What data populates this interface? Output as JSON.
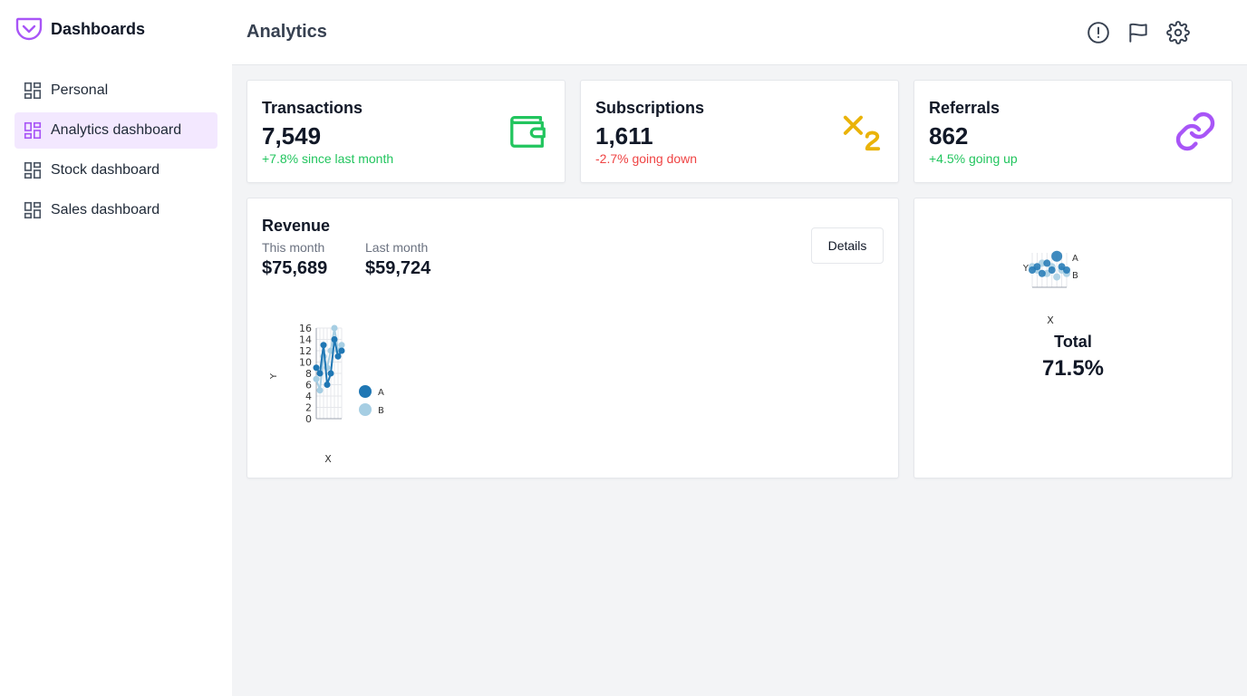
{
  "brand": {
    "title": "Dashboards"
  },
  "nav": [
    {
      "label": "Personal",
      "active": false
    },
    {
      "label": "Analytics dashboard",
      "active": true
    },
    {
      "label": "Stock dashboard",
      "active": false
    },
    {
      "label": "Sales dashboard",
      "active": false
    }
  ],
  "header": {
    "title": "Analytics"
  },
  "header_icons": [
    "alert-circle-icon",
    "flag-icon",
    "settings-gear-icon"
  ],
  "stats": [
    {
      "title": "Transactions",
      "value": "7,549",
      "change": "+7.8% since last month",
      "trend": "up",
      "icon": "wallet-icon",
      "color": "#22c55e"
    },
    {
      "title": "Subscriptions",
      "value": "1,611",
      "change": "-2.7% going down",
      "trend": "down",
      "icon": "subscript-icon",
      "color": "#eab308"
    },
    {
      "title": "Referrals",
      "value": "862",
      "change": "+4.5% going up",
      "trend": "up",
      "icon": "link-icon",
      "color": "#a855f7"
    }
  ],
  "revenue": {
    "title": "Revenue",
    "this_month_label": "This month",
    "this_month_value": "$75,689",
    "last_month_label": "Last month",
    "last_month_value": "$59,724",
    "details_label": "Details"
  },
  "total": {
    "label": "Total",
    "value": "71.5%"
  },
  "colors": {
    "accent": "#a855f7",
    "up": "#22c55e",
    "down": "#ef4444",
    "series_a": "#1f77b4",
    "series_b": "#a6cee3"
  },
  "chart_data": [
    {
      "type": "line",
      "xlabel": "X",
      "ylabel": "Y",
      "ylim": [
        0,
        16
      ],
      "yticks": [
        "0",
        "2",
        "4",
        "6",
        "8",
        "10",
        "12",
        "14",
        "16"
      ],
      "x": [
        1,
        2,
        3,
        4,
        5,
        6,
        7,
        8
      ],
      "series": [
        {
          "name": "A",
          "values": [
            9,
            8,
            13,
            6,
            8,
            14,
            11,
            12
          ]
        },
        {
          "name": "B",
          "values": [
            7,
            5,
            11,
            9,
            12,
            16,
            12,
            13
          ]
        }
      ],
      "legend": "right"
    },
    {
      "type": "scatter",
      "xlabel": "X",
      "ylabel": "Y",
      "x": [
        1,
        2,
        3,
        4,
        5,
        6,
        7,
        8
      ],
      "series": [
        {
          "name": "A",
          "values": [
            5,
            6,
            4,
            7,
            5,
            9,
            6,
            5
          ]
        },
        {
          "name": "B",
          "values": [
            6,
            5,
            7,
            4,
            6,
            3,
            5,
            4
          ]
        }
      ],
      "legend": "right"
    }
  ]
}
